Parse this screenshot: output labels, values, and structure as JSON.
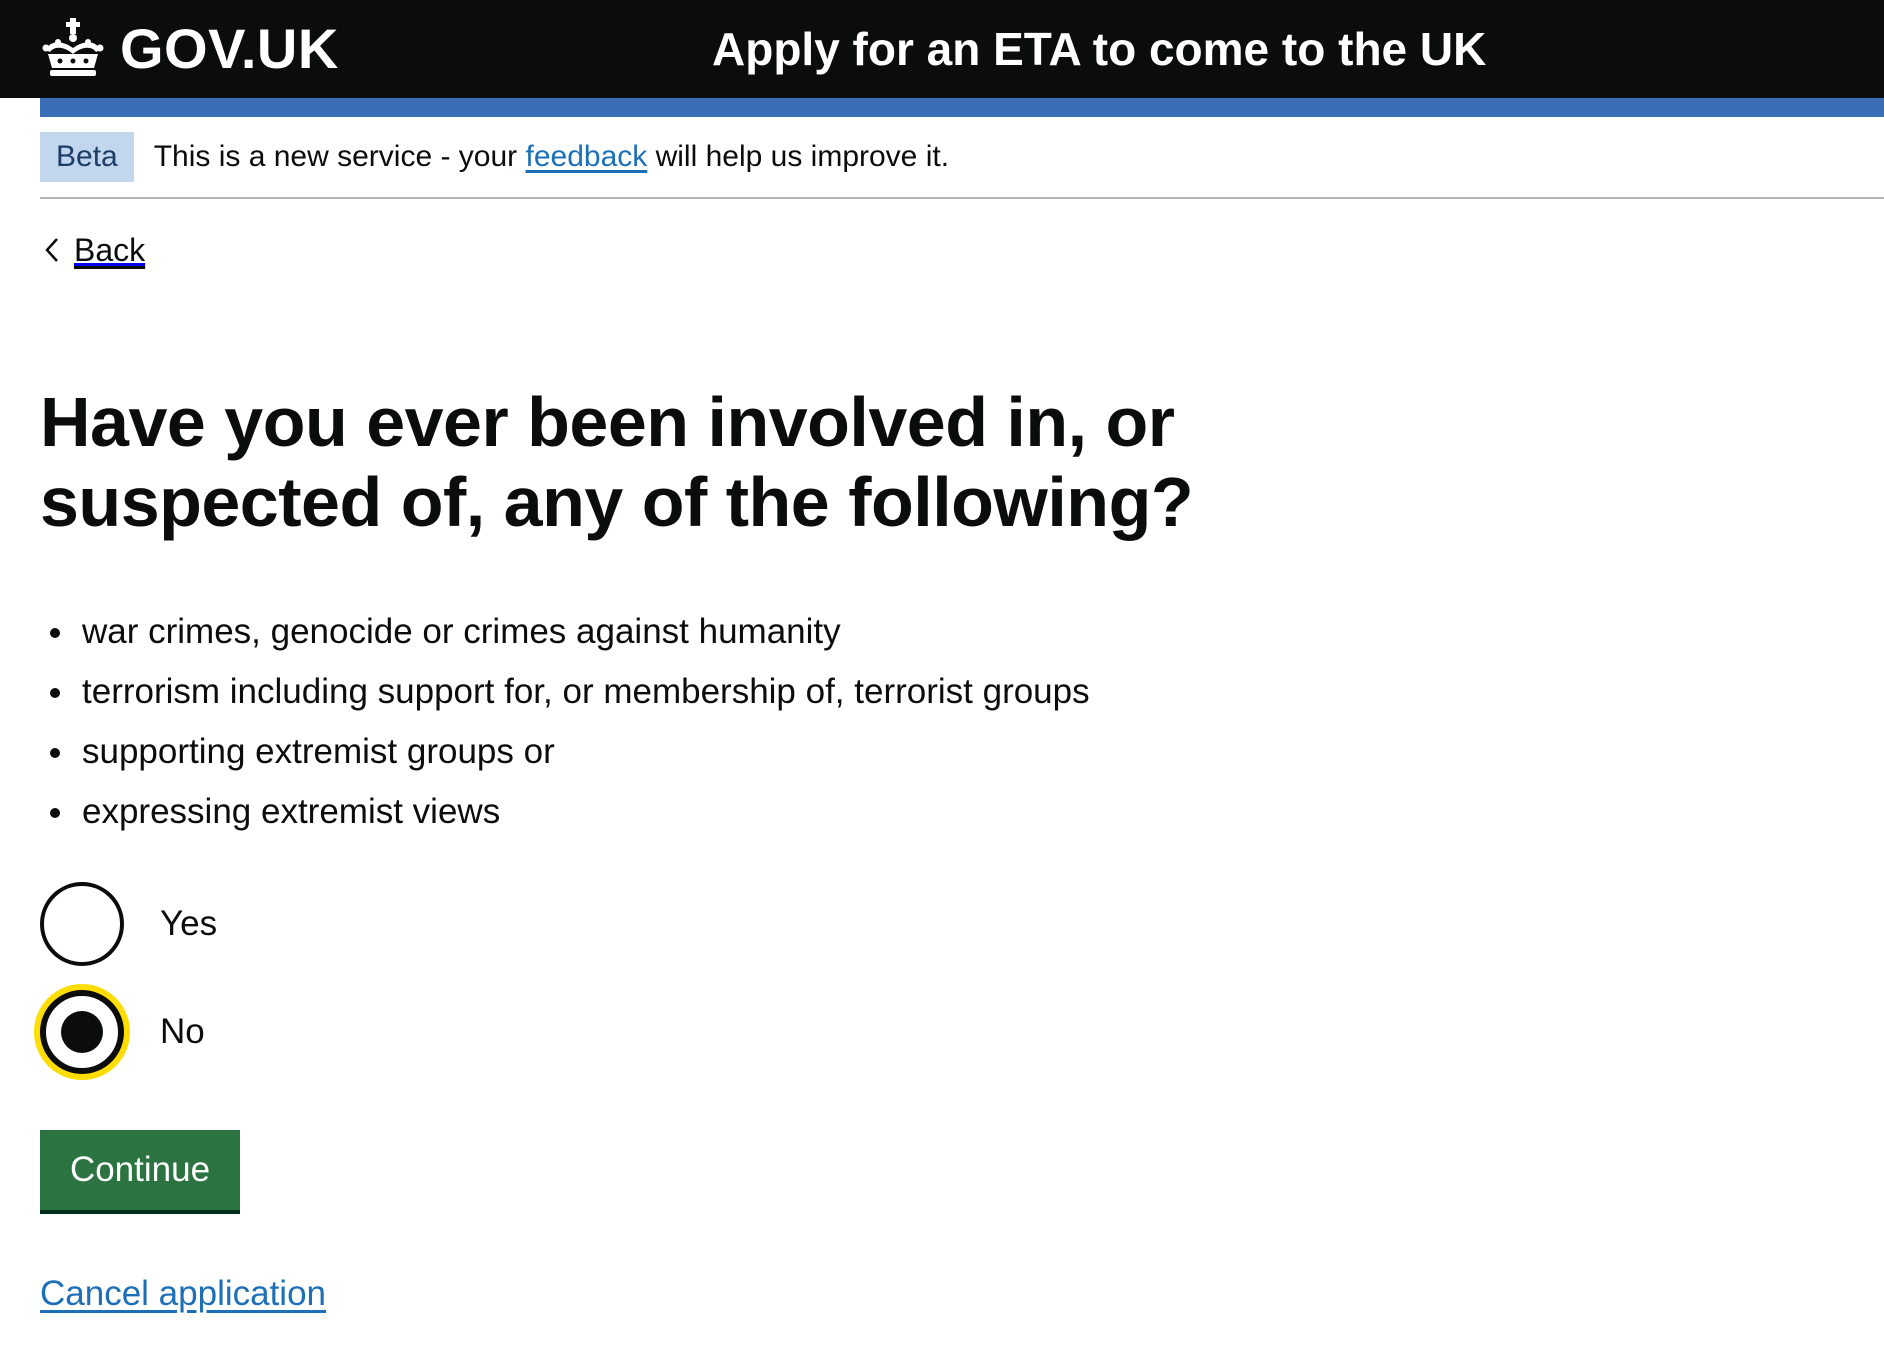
{
  "header": {
    "logo_text": "GOV.UK",
    "service_name": "Apply for an ETA to come to the UK"
  },
  "phase_banner": {
    "tag": "Beta",
    "text_before": "This is a new service - your ",
    "link_text": "feedback",
    "text_after": " will help us improve it."
  },
  "back_link": {
    "label": "Back"
  },
  "question": {
    "heading": "Have you ever been involved in, or suspected of, any of the following?",
    "items": [
      "war crimes, genocide or crimes against humanity",
      "terrorism including support for, or membership of, terrorist groups",
      "supporting extremist groups or",
      "expressing extremist views"
    ]
  },
  "radios": {
    "options": [
      {
        "label": "Yes",
        "checked": false
      },
      {
        "label": "No",
        "checked": true
      }
    ]
  },
  "actions": {
    "continue_label": "Continue",
    "cancel_label": "Cancel application"
  },
  "colors": {
    "header_bg": "#0b0c0c",
    "header_bar": "#3a6fb8",
    "link": "#1d70b8",
    "button_green": "#2b7340",
    "focus_yellow": "#ffdd00",
    "tag_bg": "#c2d6ee"
  },
  "icons": {
    "logo": "crown-icon",
    "back": "chevron-left-icon"
  }
}
